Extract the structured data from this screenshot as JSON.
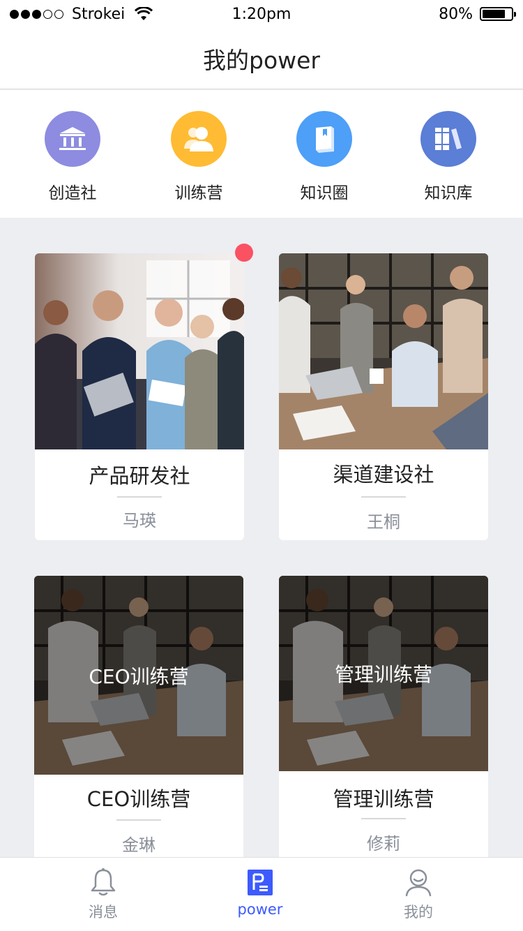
{
  "status_bar": {
    "carrier": "Strokei",
    "time": "1:20pm",
    "battery": "80%",
    "battery_level": 0.8
  },
  "nav": {
    "title": "我的power"
  },
  "categories": [
    {
      "label": "创造社",
      "icon": "institution-icon",
      "color": "#8d8ce0"
    },
    {
      "label": "训练营",
      "icon": "people-icon",
      "color": "#ffbb33"
    },
    {
      "label": "知识圈",
      "icon": "book-icon",
      "color": "#4d9ff7"
    },
    {
      "label": "知识库",
      "icon": "library-icon",
      "color": "#5b7ed6"
    }
  ],
  "cards": [
    {
      "title": "产品研发社",
      "owner": "马瑛",
      "image": "team-photo",
      "overlay": ""
    },
    {
      "title": "渠道建设社",
      "owner": "王桐",
      "image": "meeting-photo",
      "overlay": ""
    },
    {
      "title": "CEO训练营",
      "owner": "金琳",
      "image": "meeting-photo-dark",
      "overlay": "CEO训练营"
    },
    {
      "title": "管理训练营",
      "owner": "修莉",
      "image": "meeting-photo-dark",
      "overlay": "管理训练营"
    }
  ],
  "tabs": [
    {
      "label": "消息",
      "icon": "bell-icon",
      "active": false
    },
    {
      "label": "power",
      "icon": "power-doc-icon",
      "active": true
    },
    {
      "label": "我的",
      "icon": "user-icon",
      "active": false
    }
  ],
  "colors": {
    "accent": "#3d5afe",
    "badge": "#fa5163",
    "background": "#eceef1"
  }
}
